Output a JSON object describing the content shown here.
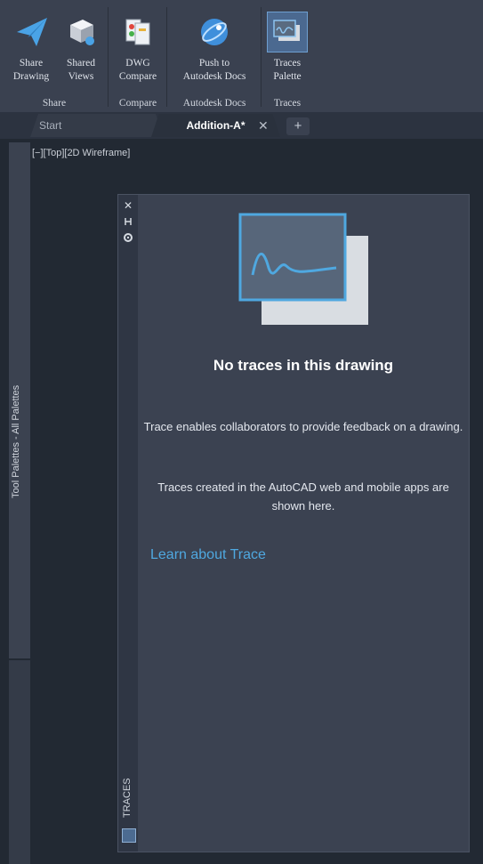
{
  "ribbon": {
    "share_panel": {
      "title": "Share",
      "tools": [
        {
          "label": "Share\nDrawing",
          "icon": "paper-plane-icon"
        },
        {
          "label": "Shared\nViews",
          "icon": "shared-views-icon"
        }
      ]
    },
    "compare_panel": {
      "title": "Compare",
      "tools": [
        {
          "label": "DWG\nCompare",
          "icon": "dwg-compare-icon"
        }
      ]
    },
    "docs_panel": {
      "title": "Autodesk Docs",
      "tools": [
        {
          "label": "Push to\nAutodesk Docs",
          "icon": "globe-icon"
        }
      ]
    },
    "traces_panel": {
      "title": "Traces",
      "tools": [
        {
          "label": "Traces\nPalette",
          "icon": "traces-palette-icon"
        }
      ]
    }
  },
  "tabs": {
    "start": "Start",
    "active": "Addition-A*",
    "close": "✕",
    "add": "+"
  },
  "viewport": {
    "label": "[−][Top][2D Wireframe]"
  },
  "left_palette": {
    "label": "Tool Palettes - All Palettes"
  },
  "traces_palette": {
    "strip_label": "TRACES",
    "strip_close": "✕",
    "empty_title": "No traces in this drawing",
    "description_1": "Trace enables collaborators to provide feedback on a drawing.",
    "description_2": "Traces created in the AutoCAD web and mobile apps are shown here.",
    "link": "Learn about Trace"
  },
  "colors": {
    "accent": "#4fa8e0",
    "palette_bg": "#3b4251",
    "ribbon_bg": "#3a4150"
  }
}
